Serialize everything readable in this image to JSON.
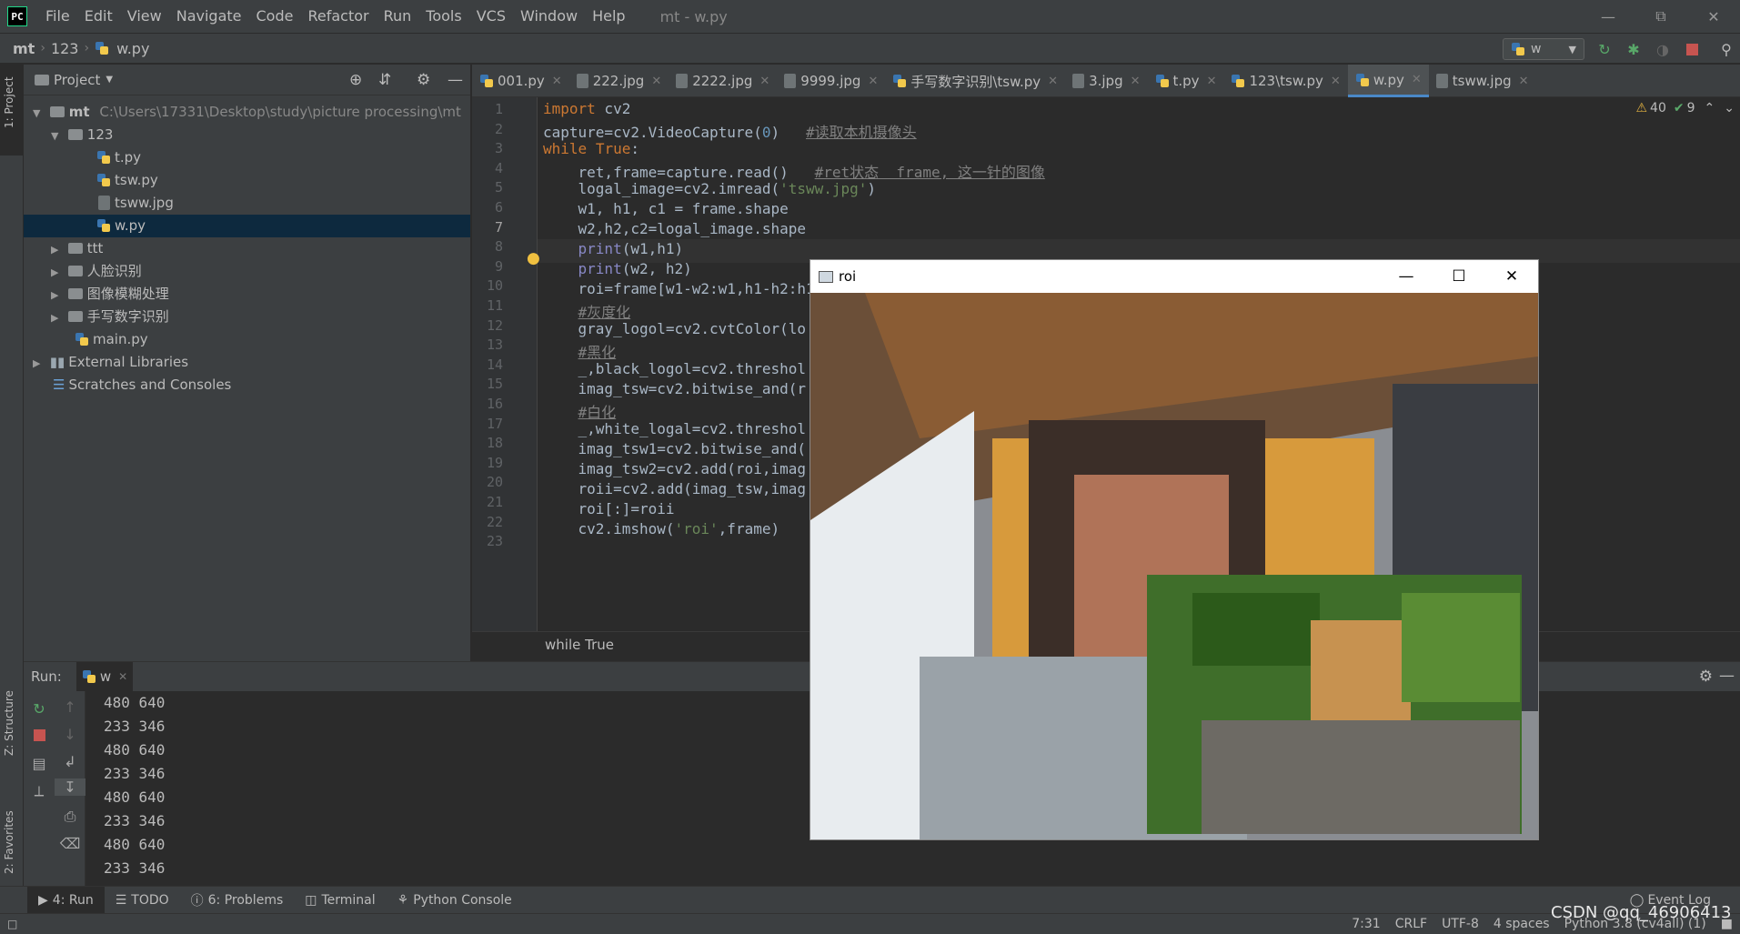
{
  "menu": {
    "items": [
      "File",
      "Edit",
      "View",
      "Navigate",
      "Code",
      "Refactor",
      "Run",
      "Tools",
      "VCS",
      "Window",
      "Help"
    ],
    "window_title": "mt - w.py"
  },
  "nav": {
    "crumbs": [
      "mt",
      "123",
      "w.py"
    ],
    "run_config": "w"
  },
  "left_strip": {
    "project": "1: Project",
    "structure": "Z: Structure",
    "favorites": "2: Favorites"
  },
  "project": {
    "header": "Project",
    "root_name": "mt",
    "root_path": "C:\\Users\\17331\\Desktop\\study\\picture processing\\mt",
    "folder_123": "123",
    "files_123": [
      "t.py",
      "tsw.py",
      "tsww.jpg",
      "w.py"
    ],
    "folders": [
      "ttt",
      "人脸识别",
      "图像模糊处理",
      "手写数字识别"
    ],
    "main": "main.py",
    "external": "External Libraries",
    "scratches": "Scratches and Consoles"
  },
  "tabs": [
    "001.py",
    "222.jpg",
    "2222.jpg",
    "9999.jpg",
    "手写数字识别\\tsw.py",
    "3.jpg",
    "t.py",
    "123\\tsw.py",
    "w.py",
    "tsww.jpg"
  ],
  "editor": {
    "warnings": "40",
    "weak": "9",
    "breadcrumb": "while True",
    "line_numbers": [
      "1",
      "2",
      "3",
      "4",
      "5",
      "6",
      "7",
      "8",
      "9",
      "10",
      "11",
      "12",
      "13",
      "14",
      "15",
      "16",
      "17",
      "18",
      "19",
      "20",
      "21",
      "22",
      "23"
    ],
    "current_line": "7"
  },
  "run": {
    "label": "Run:",
    "config": "w",
    "output": [
      "480 640",
      "233 346",
      "480 640",
      "233 346",
      "480 640",
      "233 346",
      "480 640",
      "233 346"
    ]
  },
  "bottom_tabs": [
    "4: Run",
    "TODO",
    "6: Problems",
    "Terminal",
    "Python Console"
  ],
  "event_log": "Event Log",
  "status": {
    "position": "7:31",
    "line_sep": "CRLF",
    "encoding": "UTF-8",
    "indent": "4 spaces",
    "interpreter": "Python 3.8 (cv4all) (1)"
  },
  "roi_window": {
    "title": "roi"
  },
  "watermark": "CSDN @qq_46906413",
  "colors": {
    "keyword": "#cc7832",
    "number": "#6897bb",
    "string": "#6a8759",
    "comment": "#808080",
    "accent": "#4a88c7"
  }
}
